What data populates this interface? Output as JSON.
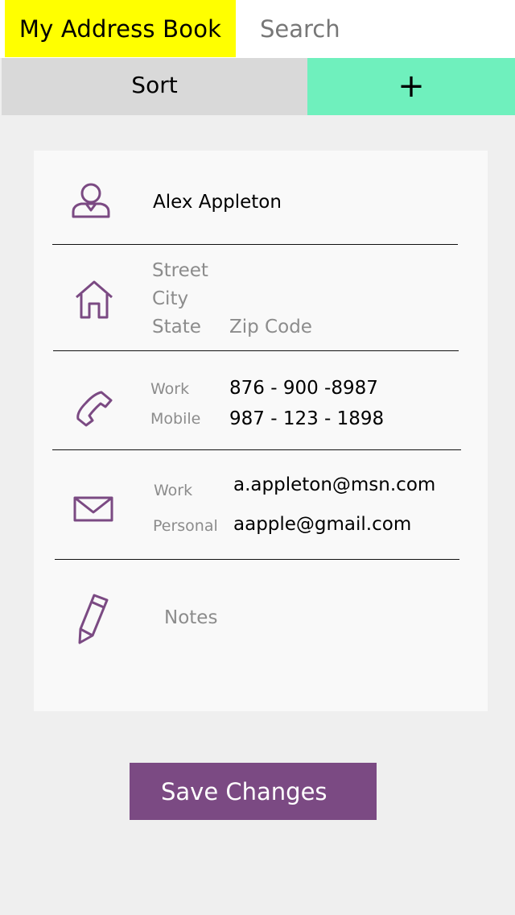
{
  "header": {
    "title": "My Address Book",
    "search_label": "Search"
  },
  "toolbar": {
    "sort_label": "Sort",
    "add_label": "+"
  },
  "contact": {
    "name": "Alex Appleton",
    "address": {
      "street_placeholder": "Street",
      "city_placeholder": "City",
      "state_placeholder": "State",
      "zip_placeholder": "Zip Code"
    },
    "phones": [
      {
        "label": "Work",
        "value": "876 - 900 -8987"
      },
      {
        "label": "Mobile",
        "value": "987 - 123 - 1898"
      }
    ],
    "emails": [
      {
        "label": "Work",
        "value": "a.appleton@msn.com"
      },
      {
        "label": "Personal",
        "value": "aapple@gmail.com"
      }
    ],
    "notes_placeholder": "Notes"
  },
  "actions": {
    "save_label": "Save Changes"
  },
  "colors": {
    "brand_bg": "#ffff00",
    "add_bg": "#6ff0bd",
    "sort_bg": "#d9d9d9",
    "accent": "#7b4a83",
    "icon": "#7b4a83"
  },
  "icons": [
    "user-icon",
    "home-icon",
    "phone-icon",
    "envelope-icon",
    "pencil-icon"
  ]
}
